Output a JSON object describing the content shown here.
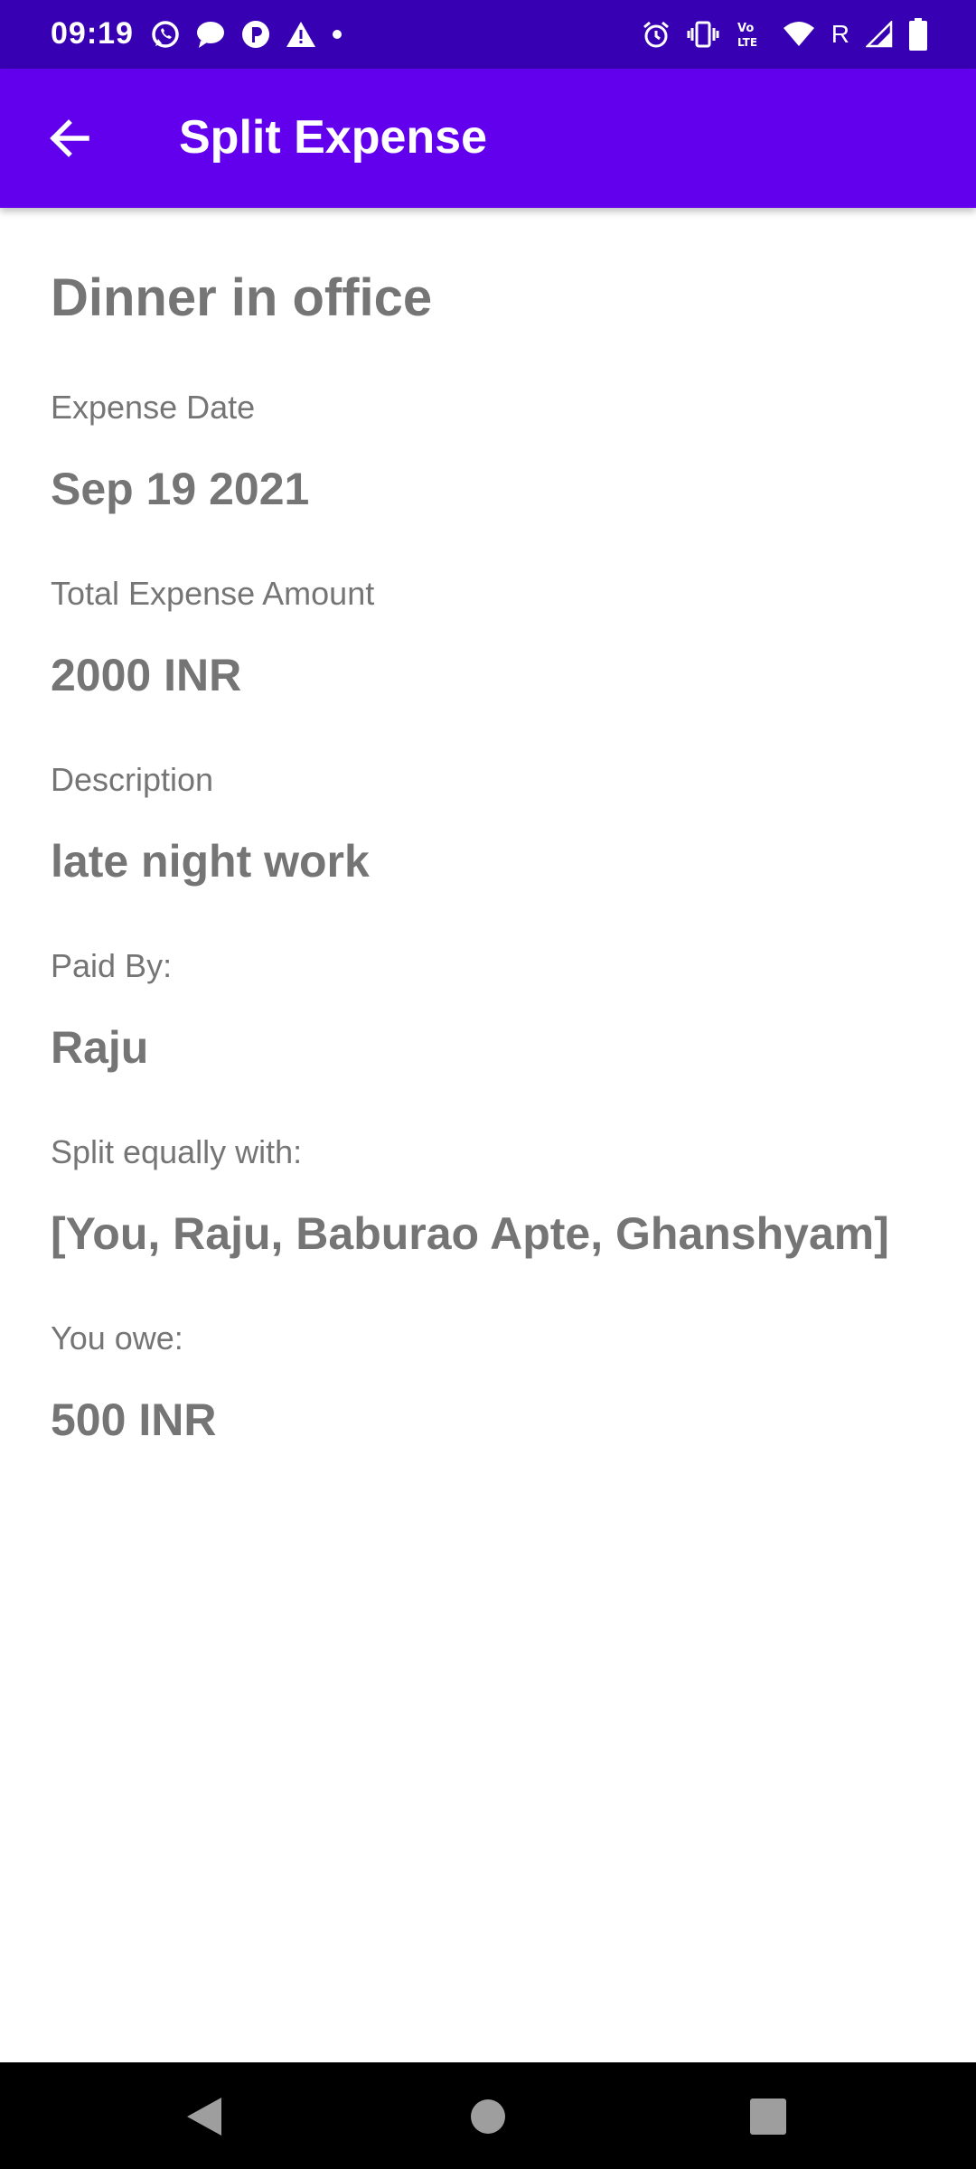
{
  "status_bar": {
    "time": "09:19",
    "left_icons": [
      "whatsapp-icon",
      "chat-bubble-icon",
      "pixel-icon",
      "warning-icon",
      "dot-icon"
    ],
    "right_icons": [
      "alarm-icon",
      "vibrate-icon",
      "volte-icon",
      "wifi-icon",
      "signal-icon",
      "battery-icon"
    ],
    "roaming_label": "R"
  },
  "app_bar": {
    "title": "Split Expense",
    "back_icon": "arrow-back-icon",
    "background": "#6200ee"
  },
  "expense": {
    "title": "Dinner in office",
    "fields": [
      {
        "label": "Expense Date",
        "value": "Sep 19 2021"
      },
      {
        "label": "Total Expense Amount",
        "value": "2000 INR"
      },
      {
        "label": "Description",
        "value": "late night work"
      },
      {
        "label": "Paid By:",
        "value": "Raju"
      },
      {
        "label": "Split equally with:",
        "value": "[You, Raju, Baburao Apte, Ghanshyam]"
      },
      {
        "label": "You owe:",
        "value": "500 INR"
      }
    ]
  },
  "nav_bar": {
    "buttons": [
      "back-triangle-icon",
      "home-circle-icon",
      "recents-square-icon"
    ]
  },
  "colors": {
    "status_bar": "#3700b3",
    "text_gray": "#757575"
  }
}
